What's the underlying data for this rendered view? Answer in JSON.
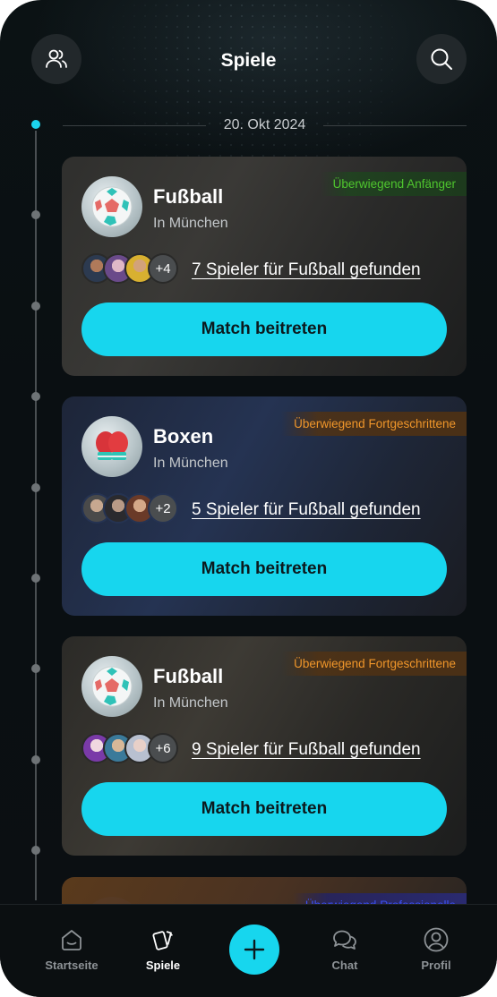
{
  "header": {
    "title": "Spiele",
    "left_icon": "users-icon",
    "right_icon": "search-icon"
  },
  "timeline": {
    "date": "20. Okt 2024"
  },
  "cards": [
    {
      "sport": "Fußball",
      "location": "In München",
      "level": "Überwiegend Anfänger",
      "level_color": "#4fc62e",
      "more_count": "+4",
      "players_text": "7 Spieler für Fußball gefunden",
      "button": "Match beitreten"
    },
    {
      "sport": "Boxen",
      "location": "In München",
      "level": "Überwiegend Fortgeschrittene",
      "level_color": "#f0962a",
      "more_count": "+2",
      "players_text": "5 Spieler für Fußball gefunden",
      "button": "Match beitreten"
    },
    {
      "sport": "Fußball",
      "location": "In München",
      "level": "Überwiegend Fortgeschrittene",
      "level_color": "#f0962a",
      "more_count": "+6",
      "players_text": "9 Spieler für Fußball gefunden",
      "button": "Match beitreten"
    },
    {
      "level": "Überwiegend Professionelle",
      "level_color": "#3b4ff0"
    }
  ],
  "nav": {
    "items": [
      {
        "label": "Startseite",
        "icon": "home-icon",
        "active": false
      },
      {
        "label": "Spiele",
        "icon": "cards-icon",
        "active": true
      },
      {
        "label": "",
        "icon": "plus-icon",
        "active": false
      },
      {
        "label": "Chat",
        "icon": "chat-icon",
        "active": false
      },
      {
        "label": "Profil",
        "icon": "profile-icon",
        "active": false
      }
    ]
  },
  "colors": {
    "accent": "#17d6ee",
    "background": "#0b1214"
  }
}
